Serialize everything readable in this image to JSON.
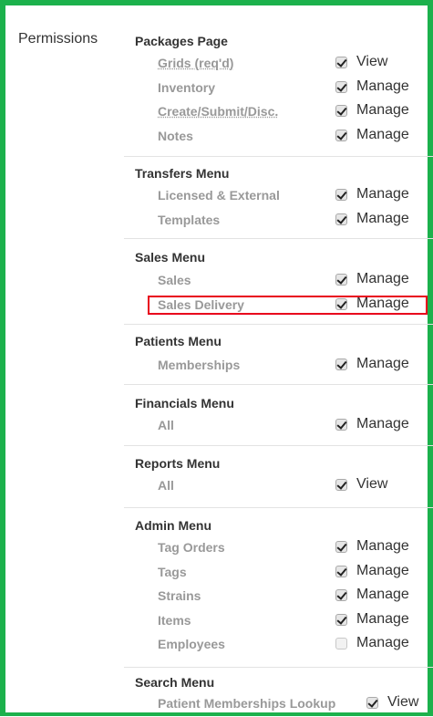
{
  "permissions_label": "Permissions",
  "sections": [
    {
      "title": "Packages Page",
      "rows": [
        {
          "label": "Grids (req'd)",
          "checked": true,
          "permission": "View"
        },
        {
          "label": "Inventory",
          "checked": true,
          "permission": "Manage"
        },
        {
          "label": "Create/Submit/Disc.",
          "checked": true,
          "permission": "Manage"
        },
        {
          "label": "Notes",
          "checked": true,
          "permission": "Manage"
        }
      ]
    },
    {
      "title": "Transfers Menu",
      "rows": [
        {
          "label": "Licensed & External",
          "checked": true,
          "permission": "Manage"
        },
        {
          "label": "Templates",
          "checked": true,
          "permission": "Manage"
        }
      ]
    },
    {
      "title": "Sales Menu",
      "rows": [
        {
          "label": "Sales",
          "checked": true,
          "permission": "Manage"
        },
        {
          "label": "Sales Delivery",
          "checked": true,
          "permission": "Manage"
        }
      ]
    },
    {
      "title": "Patients Menu",
      "rows": [
        {
          "label": "Memberships",
          "checked": true,
          "permission": "Manage"
        }
      ]
    },
    {
      "title": "Financials Menu",
      "rows": [
        {
          "label": "All",
          "checked": true,
          "permission": "Manage"
        }
      ]
    },
    {
      "title": "Reports Menu",
      "rows": [
        {
          "label": "All",
          "checked": true,
          "permission": "View"
        }
      ]
    },
    {
      "title": "Admin Menu",
      "rows": [
        {
          "label": "Tag Orders",
          "checked": true,
          "permission": "Manage"
        },
        {
          "label": "Tags",
          "checked": true,
          "permission": "Manage"
        },
        {
          "label": "Strains",
          "checked": true,
          "permission": "Manage"
        },
        {
          "label": "Items",
          "checked": true,
          "permission": "Manage"
        },
        {
          "label": "Employees",
          "checked": false,
          "permission": "Manage"
        }
      ]
    },
    {
      "title": "Search Menu",
      "rows": [
        {
          "label": "Patient Memberships Lookup",
          "checked": true,
          "permission": "View"
        }
      ]
    }
  ],
  "colors": {
    "frame": "#1cb14c",
    "highlight": "#e8001c"
  }
}
